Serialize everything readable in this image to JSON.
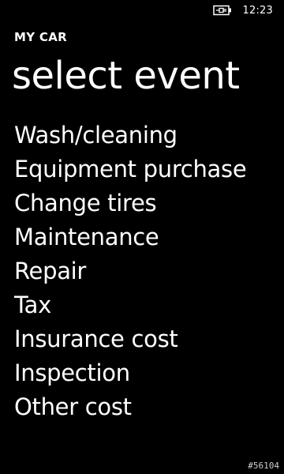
{
  "status_bar": {
    "time": "12:23",
    "battery_icon": "battery-charging-icon"
  },
  "header": {
    "app_title": "MY CAR",
    "page_title": "select event"
  },
  "events": [
    {
      "label": "Wash/cleaning"
    },
    {
      "label": "Equipment purchase"
    },
    {
      "label": "Change tires"
    },
    {
      "label": "Maintenance"
    },
    {
      "label": "Repair"
    },
    {
      "label": "Tax"
    },
    {
      "label": "Insurance cost"
    },
    {
      "label": "Inspection"
    },
    {
      "label": "Other cost"
    }
  ],
  "watermark": "#56104",
  "colors": {
    "background": "#000000",
    "foreground": "#ffffff"
  }
}
